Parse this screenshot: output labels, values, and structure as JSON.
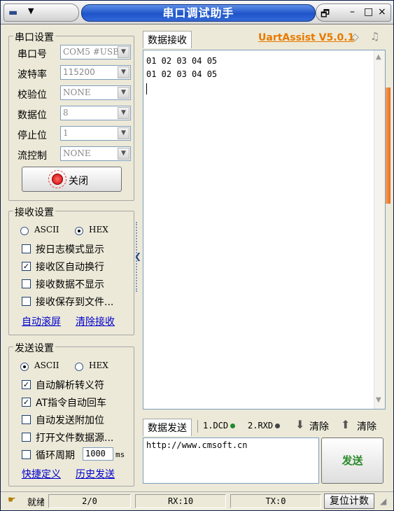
{
  "window": {
    "title": "串口调试助手",
    "controls": {
      "restore": "🗗",
      "minimize": "–",
      "maximize": "□",
      "close": "×"
    }
  },
  "serial": {
    "group_title": "串口设置",
    "fields": [
      {
        "label": "串口号",
        "value": "COM5 #USB"
      },
      {
        "label": "波特率",
        "value": "115200"
      },
      {
        "label": "校验位",
        "value": "NONE"
      },
      {
        "label": "数据位",
        "value": "8"
      },
      {
        "label": "停止位",
        "value": "1"
      },
      {
        "label": "流控制",
        "value": "NONE"
      }
    ],
    "close_button": "关闭"
  },
  "recv_settings": {
    "group_title": "接收设置",
    "ascii": "ASCII",
    "hex": "HEX",
    "options": [
      {
        "label": "按日志模式显示",
        "checked": false
      },
      {
        "label": "接收区自动换行",
        "checked": true
      },
      {
        "label": "接收数据不显示",
        "checked": false
      },
      {
        "label": "接收保存到文件...",
        "checked": false
      }
    ],
    "link_auto_scroll": "自动滚屏",
    "link_clear": "清除接收"
  },
  "send_settings": {
    "group_title": "发送设置",
    "ascii": "ASCII",
    "hex": "HEX",
    "options": [
      {
        "label": "自动解析转义符",
        "checked": true
      },
      {
        "label": "AT指令自动回车",
        "checked": true
      },
      {
        "label": "自动发送附加位",
        "checked": false
      },
      {
        "label": "打开文件数据源...",
        "checked": false
      }
    ],
    "loop_label": "循环周期",
    "loop_value": "1000",
    "loop_unit": "ms",
    "link_shortcut": "快捷定义",
    "link_history": "历史发送"
  },
  "receive": {
    "tab": "数据接收",
    "version": "UartAssist V5.0.1",
    "lines": [
      "01 02 03 04 05",
      "01 02 03 04 05"
    ]
  },
  "send": {
    "tab": "数据发送",
    "dcd": "1.DCD",
    "rxd": "2.RXD",
    "clear1": "清除",
    "clear2": "清除",
    "text": "http://www.cmsoft.cn",
    "button": "发送"
  },
  "status": {
    "ready": "就绪",
    "frames": "2/0",
    "rx": "RX:10",
    "tx": "TX:0",
    "reset": "复位计数"
  },
  "colors": {
    "accent_title": "#1e54c8",
    "version": "#e87a00",
    "link": "#0000cc",
    "send_button": "#2a8a2a"
  }
}
